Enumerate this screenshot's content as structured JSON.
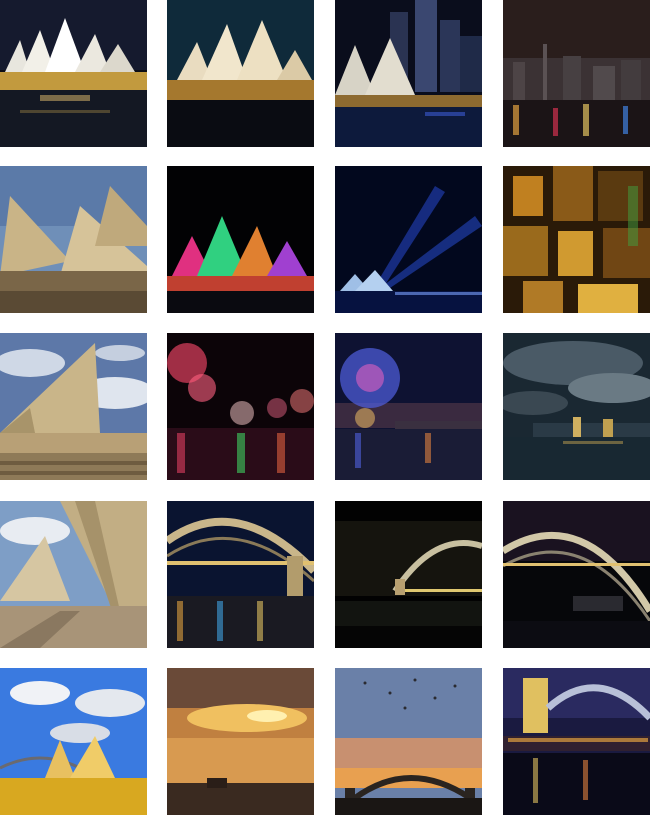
{
  "gallery": {
    "rows": 5,
    "columns": 4,
    "tiles": [
      {
        "subject": "opera-house-night-reflection"
      },
      {
        "subject": "opera-house-night-lit"
      },
      {
        "subject": "opera-house-city-skyline-night"
      },
      {
        "subject": "city-skyline-night-reflection"
      },
      {
        "subject": "opera-house-shells-closeup"
      },
      {
        "subject": "opera-house-vivid-lights"
      },
      {
        "subject": "opera-house-searchlights"
      },
      {
        "subject": "city-aerial-night"
      },
      {
        "subject": "opera-house-shell-clouds"
      },
      {
        "subject": "fireworks-harbour-red"
      },
      {
        "subject": "fireworks-harbour-blue"
      },
      {
        "subject": "stormy-city-skyline"
      },
      {
        "subject": "opera-house-walkway"
      },
      {
        "subject": "harbour-bridge-night-1"
      },
      {
        "subject": "harbour-bridge-night-2"
      },
      {
        "subject": "harbour-bridge-night-3"
      },
      {
        "subject": "opera-house-golden-clouds"
      },
      {
        "subject": "harbour-sunset-clouds"
      },
      {
        "subject": "harbour-bridge-dusk-birds"
      },
      {
        "subject": "harbour-bridge-pylon-night"
      }
    ]
  }
}
